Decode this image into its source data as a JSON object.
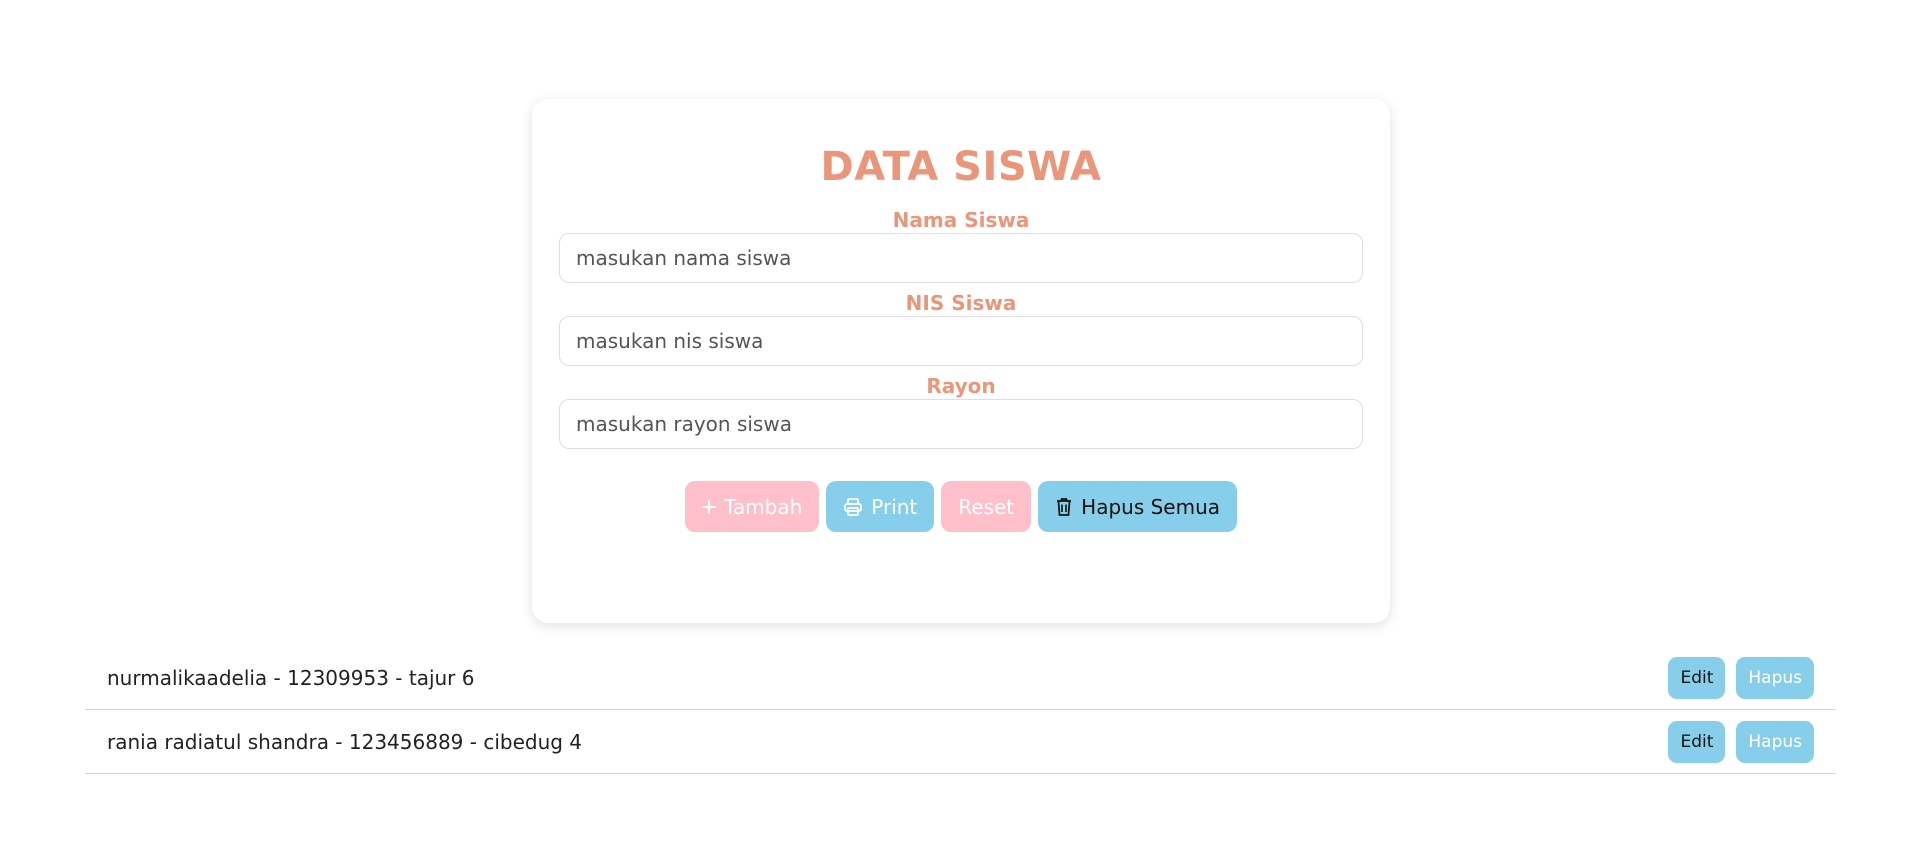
{
  "form": {
    "title": "DATA SISWA",
    "fields": [
      {
        "label": "Nama Siswa",
        "placeholder": "masukan nama siswa",
        "value": ""
      },
      {
        "label": "NIS Siswa",
        "placeholder": "masukan nis siswa",
        "value": ""
      },
      {
        "label": "Rayon",
        "placeholder": "masukan rayon siswa",
        "value": ""
      }
    ],
    "buttons": {
      "tambah": "Tambah",
      "print": "Print",
      "reset": "Reset",
      "hapus_semua": "Hapus Semua"
    },
    "icons": {
      "tambah": "plus-icon",
      "print": "printer-icon",
      "hapus_semua": "trash-icon"
    }
  },
  "list": {
    "items": [
      {
        "text": "nurmalikaadelia - 12309953 - tajur 6",
        "edit": "Edit",
        "hapus": "Hapus"
      },
      {
        "text": "rania radiatul shandra - 123456889 - cibedug 4",
        "edit": "Edit",
        "hapus": "Hapus"
      }
    ]
  },
  "colors": {
    "accent": "#E9967A",
    "pink": "#FFC0CB",
    "blue": "#87CEEB"
  }
}
